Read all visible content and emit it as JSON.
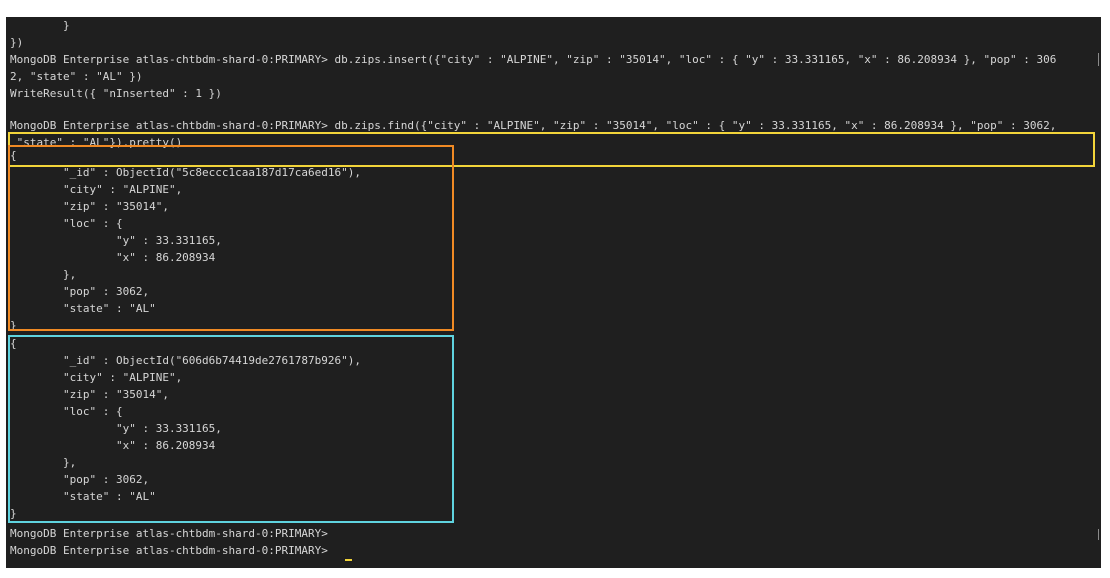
{
  "terminal": {
    "lines": [
      "        }",
      "})",
      "MongoDB Enterprise atlas-chtbdm-shard-0:PRIMARY> db.zips.insert({\"city\" : \"ALPINE\", \"zip\" : \"35014\", \"loc\" : { \"y\" : 33.331165, \"x\" : 86.208934 }, \"pop\" : 306",
      "2, \"state\" : \"AL\" })",
      "WriteResult({ \"nInserted\" : 1 })",
      "MongoDB Enterprise atlas-chtbdm-shard-0:PRIMARY> db.zips.find({\"city\" : \"ALPINE\", \"zip\" : \"35014\", \"loc\" : { \"y\" : 33.331165, \"x\" : 86.208934 }, \"pop\" : 3062,",
      " \"state\" : \"AL\"}).pretty()",
      "{",
      "        \"_id\" : ObjectId(\"5c8eccc1caa187d17ca6ed16\"),",
      "        \"city\" : \"ALPINE\",",
      "        \"zip\" : \"35014\",",
      "        \"loc\" : {",
      "                \"y\" : 33.331165,",
      "                \"x\" : 86.208934",
      "        },",
      "        \"pop\" : 3062,",
      "        \"state\" : \"AL\"",
      "}",
      "{",
      "        \"_id\" : ObjectId(\"606d6b74419de2761787b926\"),",
      "        \"city\" : \"ALPINE\",",
      "        \"zip\" : \"35014\",",
      "        \"loc\" : {",
      "                \"y\" : 33.331165,",
      "                \"x\" : 86.208934",
      "        },",
      "        \"pop\" : 3062,",
      "        \"state\" : \"AL\"",
      "}",
      "MongoDB Enterprise atlas-chtbdm-shard-0:PRIMARY>",
      "MongoDB Enterprise atlas-chtbdm-shard-0:PRIMARY> "
    ]
  },
  "highlight_colors": {
    "query": "#f2d43a",
    "existing_document": "#f08a24",
    "inserted_document": "#5fd3df"
  }
}
